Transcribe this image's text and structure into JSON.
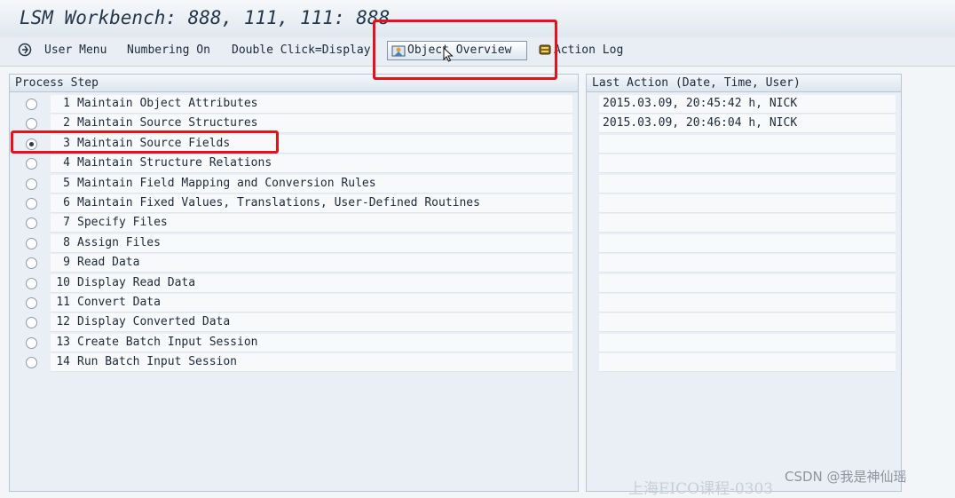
{
  "window": {
    "title": "LSM Workbench: 888, 111, 111: 888"
  },
  "toolbar": {
    "user_menu": "User Menu",
    "numbering": "Numbering On",
    "double_click": "Double Click=Display",
    "object_overview": "Object Overview",
    "action_log": "Action Log"
  },
  "process_panel": {
    "header": "Process Step",
    "selected_step": 3,
    "steps": [
      {
        "num": "1",
        "label": "Maintain Object Attributes"
      },
      {
        "num": "2",
        "label": "Maintain Source Structures"
      },
      {
        "num": "3",
        "label": "Maintain Source Fields"
      },
      {
        "num": "4",
        "label": "Maintain Structure Relations"
      },
      {
        "num": "5",
        "label": "Maintain Field Mapping and Conversion Rules"
      },
      {
        "num": "6",
        "label": "Maintain Fixed Values, Translations, User-Defined Routines"
      },
      {
        "num": "7",
        "label": "Specify Files"
      },
      {
        "num": "8",
        "label": "Assign Files"
      },
      {
        "num": "9",
        "label": "Read Data"
      },
      {
        "num": "10",
        "label": "Display Read Data"
      },
      {
        "num": "11",
        "label": "Convert Data"
      },
      {
        "num": "12",
        "label": "Display Converted Data"
      },
      {
        "num": "13",
        "label": "Create Batch Input Session"
      },
      {
        "num": "14",
        "label": "Run Batch Input Session"
      }
    ]
  },
  "action_panel": {
    "header": "Last Action (Date, Time, User)",
    "entries": [
      "2015.03.09, 20:45:42 h, NICK",
      "2015.03.09, 20:46:04 h, NICK"
    ]
  },
  "watermark": "CSDN @我是神仙瑶",
  "watermark2": "上海EICO课程-0303",
  "colors": {
    "highlight": "#e8101a",
    "panel_bg": "#e9eff5"
  },
  "icons": [
    "user-menu-icon",
    "object-overview-icon",
    "action-log-icon",
    "mouse-cursor-icon"
  ]
}
